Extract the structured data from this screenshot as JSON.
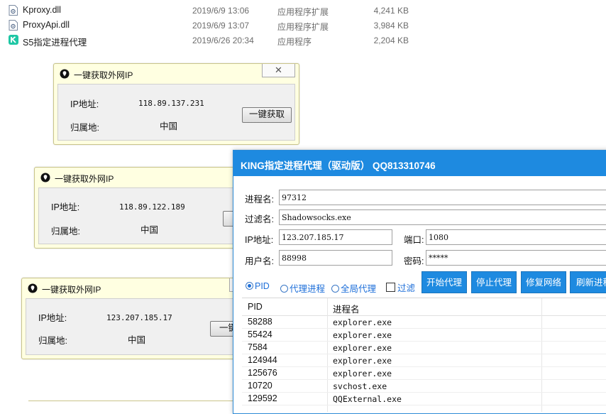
{
  "files": [
    {
      "name": "Kproxy.dll",
      "date": "2019/6/9 13:06",
      "type": "应用程序扩展",
      "size": "4,241 KB",
      "icon": "dll-file-icon"
    },
    {
      "name": "ProxyApi.dll",
      "date": "2019/6/9 13:07",
      "type": "应用程序扩展",
      "size": "3,984 KB",
      "icon": "dll-file-icon"
    },
    {
      "name": "S5指定进程代理",
      "date": "2019/6/26 20:34",
      "type": "应用程序",
      "size": "2,204 KB",
      "icon": "app-k-icon"
    }
  ],
  "ip_windows": [
    {
      "title": "一键获取外网IP",
      "ip_label": "IP地址:",
      "ip": "118.89.137.231",
      "loc_label": "归属地:",
      "loc": "中国",
      "button": "一键获取",
      "close": "✕"
    },
    {
      "title": "一键获取外网IP",
      "ip_label": "IP地址:",
      "ip": "118.89.122.189",
      "loc_label": "归属地:",
      "loc": "中国"
    },
    {
      "title": "一键获取外网IP",
      "ip_label": "IP地址:",
      "ip": "123.207.185.17",
      "loc_label": "归属地:",
      "loc": "中国",
      "button": "一键"
    }
  ],
  "king": {
    "title": "KING指定进程代理（驱动版） QQ813310746",
    "fields": {
      "process_label": "进程名:",
      "process": "97312",
      "filter_label": "过滤名:",
      "filter": "Shadowsocks.exe",
      "ip_label": "IP地址:",
      "ip": "123.207.185.17",
      "port_label": "端口:",
      "port": "1080",
      "user_label": "用户名:",
      "user": "88998",
      "pwd_label": "密码:",
      "pwd": "*****"
    },
    "modes": {
      "pid": "PID",
      "proxy_proc": "代理进程",
      "global": "全局代理",
      "filter": "过滤",
      "selected": "PID"
    },
    "buttons": {
      "start": "开始代理",
      "stop": "停止代理",
      "repair": "修复网络",
      "refresh": "刷新进程"
    },
    "table": {
      "headers": [
        "PID",
        "进程名"
      ],
      "rows": [
        {
          "pid": "58288",
          "name": "explorer.exe"
        },
        {
          "pid": "55424",
          "name": "explorer.exe"
        },
        {
          "pid": "7584",
          "name": "explorer.exe"
        },
        {
          "pid": "124944",
          "name": "explorer.exe"
        },
        {
          "pid": "125676",
          "name": "explorer.exe"
        },
        {
          "pid": "10720",
          "name": "svchost.exe"
        },
        {
          "pid": "129592",
          "name": "QQExternal.exe"
        }
      ]
    },
    "accent": "#1e8ae0"
  }
}
